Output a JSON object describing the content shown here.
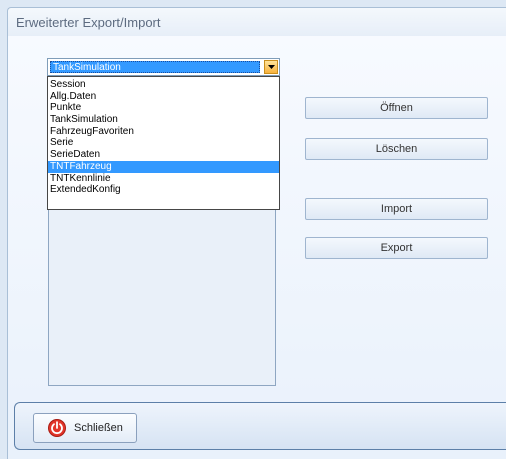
{
  "window": {
    "title": "Erweiterter Export/Import"
  },
  "combo": {
    "selected": "TankSimulation",
    "options": [
      "Session",
      "Allg.Daten",
      "Punkte",
      "TankSimulation",
      "FahrzeugFavoriten",
      "Serie",
      "SerieDaten",
      "TNTFahrzeug",
      "TNTKennlinie",
      "ExtendedKonfig"
    ],
    "highlighted": "TNTFahrzeug"
  },
  "buttons": {
    "open": "Öffnen",
    "delete": "Löschen",
    "import": "Import",
    "export": "Export"
  },
  "footer": {
    "close": "Schließen"
  },
  "colors": {
    "selection": "#3399ff",
    "accent_close": "#e2352a"
  }
}
